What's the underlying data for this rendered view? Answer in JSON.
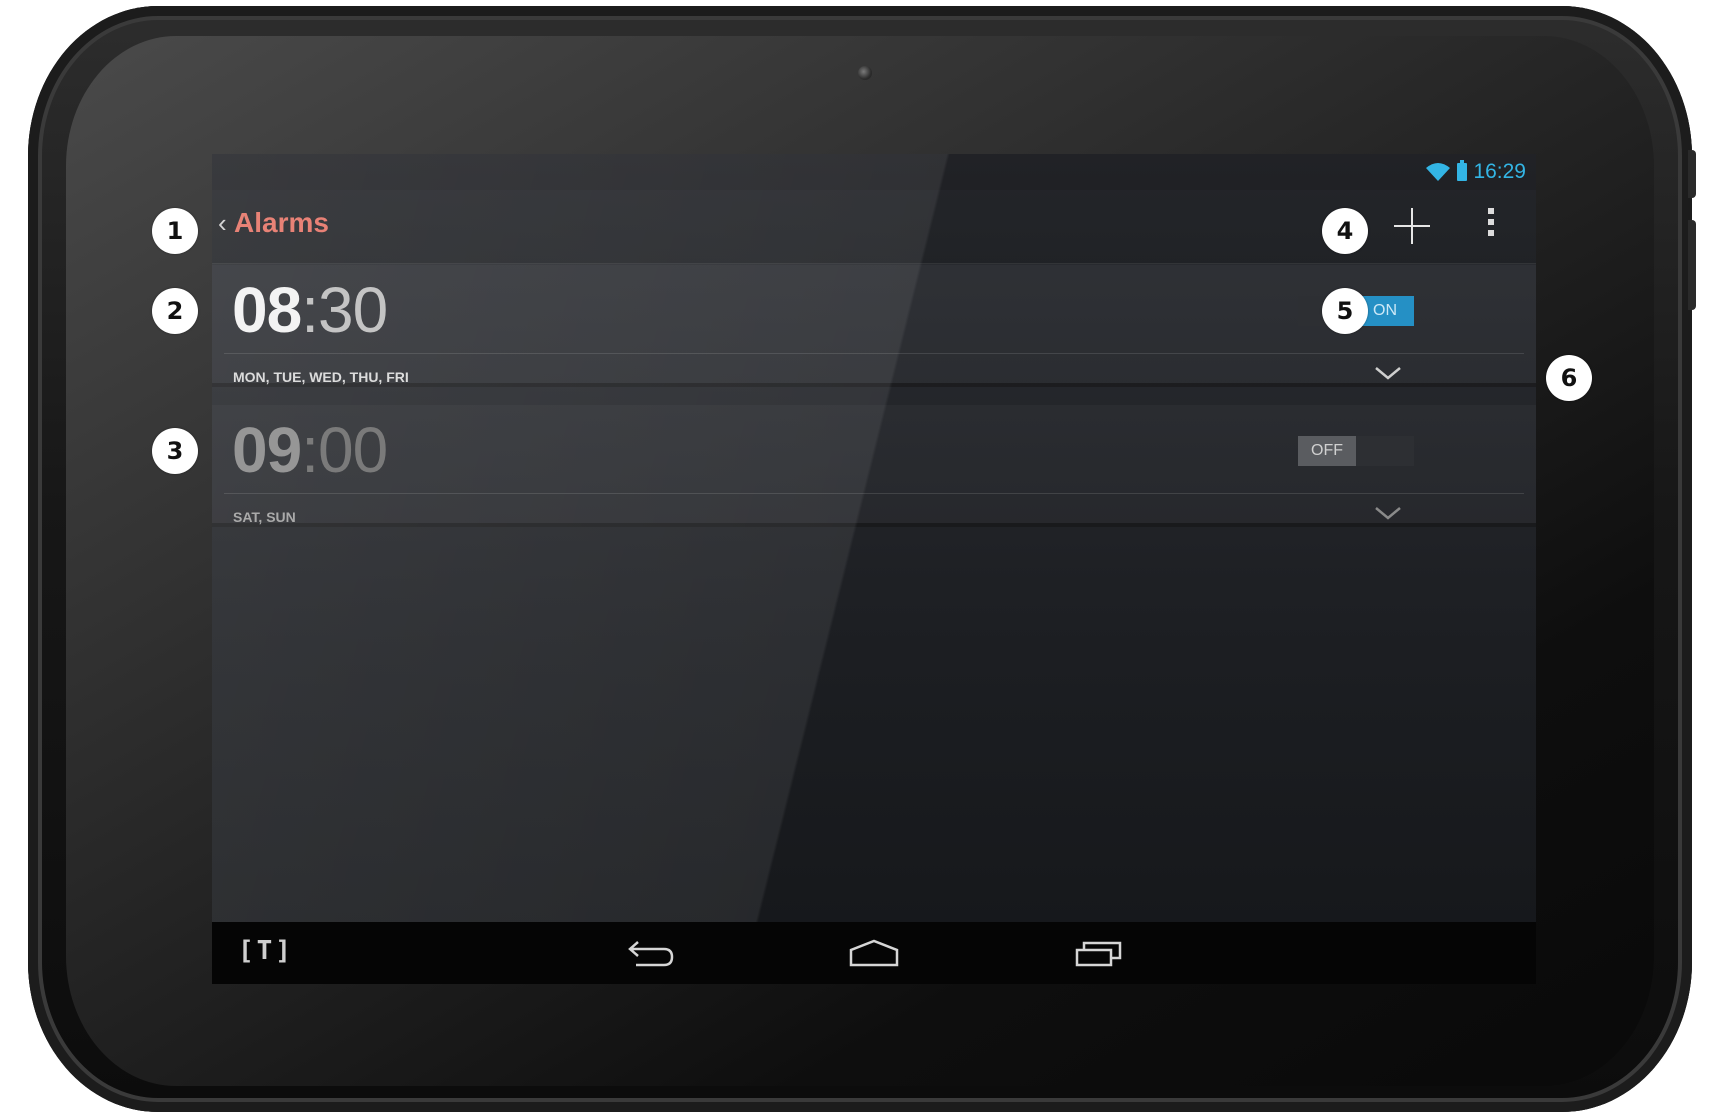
{
  "status_bar": {
    "time": "16:29",
    "wifi_icon": "wifi-icon",
    "battery_icon": "battery-icon",
    "accent": "#33b5e5"
  },
  "action_bar": {
    "title": "Alarms",
    "title_color": "#e57366",
    "add_icon": "add-icon",
    "overflow_icon": "overflow-menu-icon"
  },
  "alarms": [
    {
      "hour": "08",
      "minute": ":30",
      "days": "MON, TUE, WED, THU, FRI",
      "toggle": "ON",
      "enabled": true
    },
    {
      "hour": "09",
      "minute": ":00",
      "days": "SAT, SUN",
      "toggle": "OFF",
      "enabled": false
    }
  ],
  "nav_bar": {
    "brand": "[T]",
    "back_icon": "back-icon",
    "home_icon": "home-icon",
    "recents_icon": "recents-icon"
  },
  "callouts": [
    "1",
    "2",
    "3",
    "4",
    "5",
    "6"
  ]
}
